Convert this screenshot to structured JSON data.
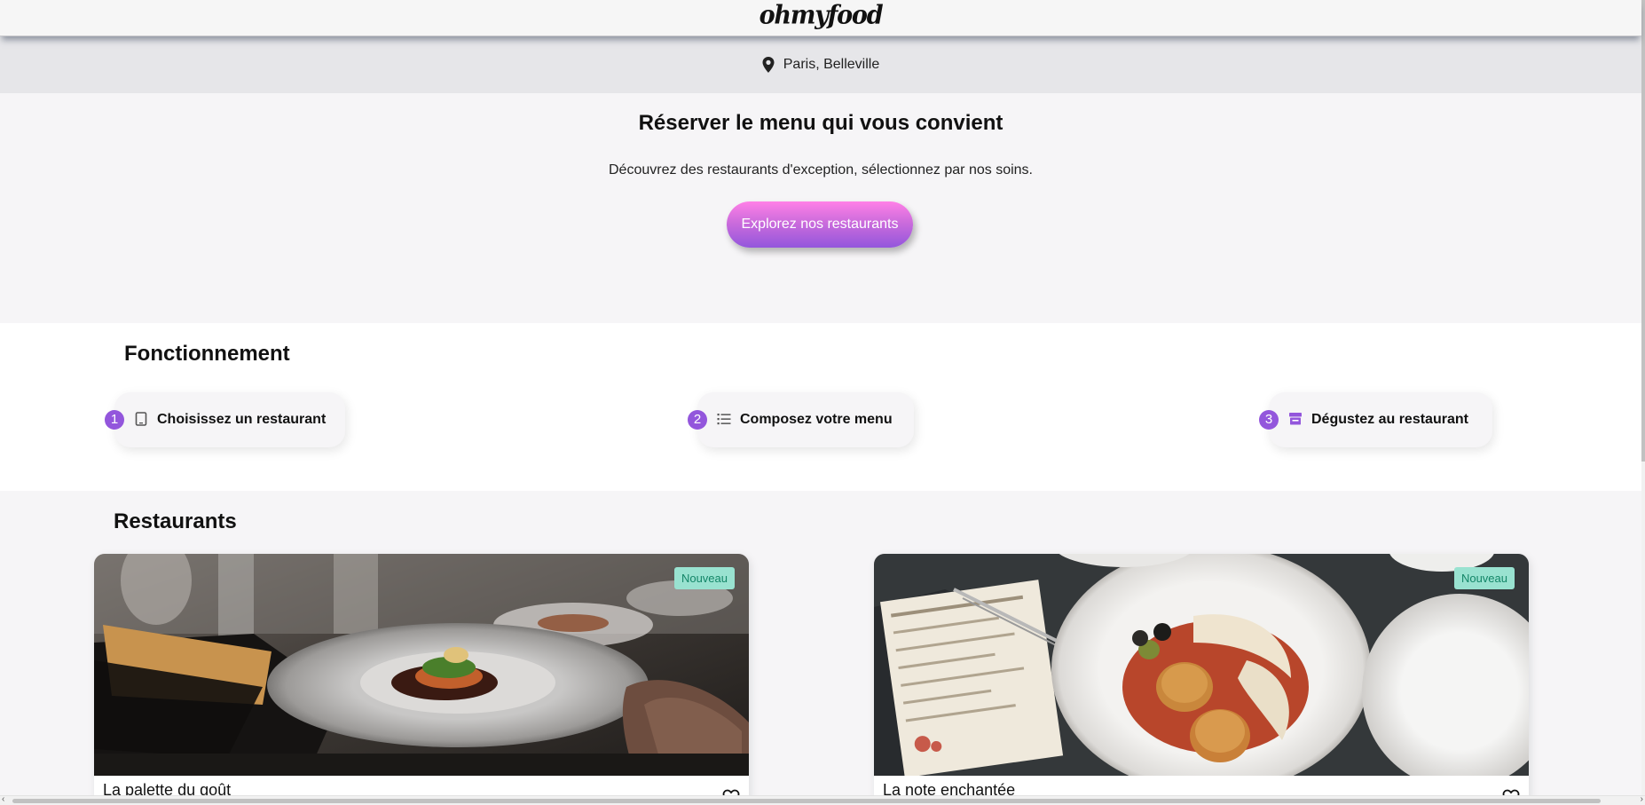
{
  "header": {
    "logo": "ohmyfood"
  },
  "location": {
    "icon": "map-pin-icon",
    "text": "Paris, Belleville"
  },
  "hero": {
    "title": "Réserver le menu qui vous convient",
    "subtitle": "Découvrez des restaurants d'exception, sélectionnez par nos soins.",
    "cta_label": "Explorez nos restaurants"
  },
  "how_it_works": {
    "title": "Fonctionnement",
    "steps": [
      {
        "number": "1",
        "icon": "mobile-phone-icon",
        "label": "Choisissez un restaurant"
      },
      {
        "number": "2",
        "icon": "list-icon",
        "label": "Composez votre menu"
      },
      {
        "number": "3",
        "icon": "store-icon",
        "label": "Dégustez au restaurant"
      }
    ]
  },
  "restaurants": {
    "title": "Restaurants",
    "cards": [
      {
        "name": "La palette du goût",
        "badge": "Nouveau",
        "icon": "heart-icon"
      },
      {
        "name": "La note enchantée",
        "badge": "Nouveau",
        "icon": "heart-icon"
      }
    ]
  },
  "colors": {
    "accent_purple": "#9356dc",
    "accent_pink": "#ff79da",
    "badge_bg": "#99e2d0",
    "badge_text": "#138567"
  }
}
